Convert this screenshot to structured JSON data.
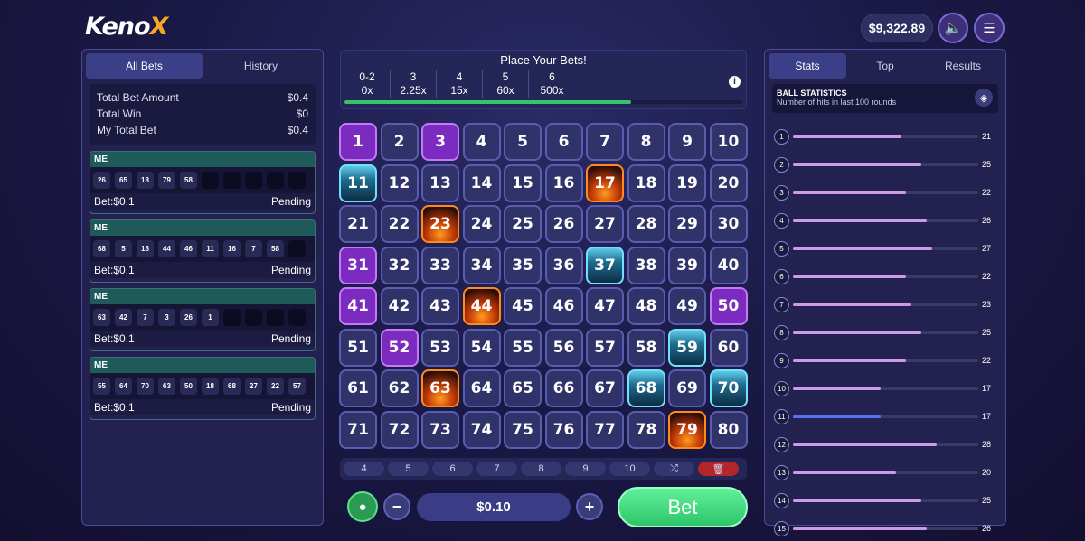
{
  "logo": {
    "main": "Keno",
    "accent": "X"
  },
  "balance": "$9,322.89",
  "left_tabs": [
    {
      "label": "All Bets"
    },
    {
      "label": "History"
    }
  ],
  "summary": [
    {
      "label": "Total Bet Amount",
      "value": "$0.4"
    },
    {
      "label": "Total Win",
      "value": "$0"
    },
    {
      "label": "My Total Bet",
      "value": "$0.4"
    }
  ],
  "bets": [
    {
      "player": "ME",
      "numbers": [
        "26",
        "65",
        "18",
        "79",
        "58",
        "",
        "",
        "",
        "",
        ""
      ],
      "bet": "Bet:$0.1",
      "status": "Pending"
    },
    {
      "player": "ME",
      "numbers": [
        "68",
        "5",
        "18",
        "44",
        "46",
        "11",
        "16",
        "7",
        "58",
        ""
      ],
      "bet": "Bet:$0.1",
      "status": "Pending"
    },
    {
      "player": "ME",
      "numbers": [
        "63",
        "42",
        "7",
        "3",
        "26",
        "1",
        "",
        "",
        "",
        ""
      ],
      "bet": "Bet:$0.1",
      "status": "Pending"
    },
    {
      "player": "ME",
      "numbers": [
        "55",
        "64",
        "70",
        "63",
        "50",
        "18",
        "68",
        "27",
        "22",
        "57"
      ],
      "bet": "Bet:$0.1",
      "status": "Pending"
    }
  ],
  "payout": {
    "title": "Place Your Bets!",
    "tiers": [
      {
        "hits": "0-2",
        "multiplier": "0x"
      },
      {
        "hits": "3",
        "multiplier": "2.25x"
      },
      {
        "hits": "4",
        "multiplier": "15x"
      },
      {
        "hits": "5",
        "multiplier": "60x"
      },
      {
        "hits": "6",
        "multiplier": "500x"
      }
    ],
    "progress": 0.72
  },
  "grid": {
    "selected": [
      1,
      3,
      31,
      41,
      50,
      52
    ],
    "hit_fire": [
      17,
      23,
      44,
      63,
      79
    ],
    "hit_ice": [
      11,
      37,
      59,
      68,
      70
    ]
  },
  "pick_options": [
    "4",
    "5",
    "6",
    "7",
    "8",
    "9",
    "10"
  ],
  "bet_amount": "$0.10",
  "bet_label": "Bet",
  "right_tabs": [
    {
      "label": "Stats"
    },
    {
      "label": "Top"
    },
    {
      "label": "Results"
    }
  ],
  "stats": {
    "title": "BALL STATISTICS",
    "subtitle": "Number of hits in last 100 rounds",
    "rows": [
      {
        "ball": "1",
        "hits": 21
      },
      {
        "ball": "2",
        "hits": 25
      },
      {
        "ball": "3",
        "hits": 22
      },
      {
        "ball": "4",
        "hits": 26
      },
      {
        "ball": "5",
        "hits": 27
      },
      {
        "ball": "6",
        "hits": 22
      },
      {
        "ball": "7",
        "hits": 23
      },
      {
        "ball": "8",
        "hits": 25
      },
      {
        "ball": "9",
        "hits": 22
      },
      {
        "ball": "10",
        "hits": 17
      },
      {
        "ball": "11",
        "hits": 17
      },
      {
        "ball": "12",
        "hits": 28
      },
      {
        "ball": "13",
        "hits": 20
      },
      {
        "ball": "14",
        "hits": 25
      },
      {
        "ball": "15",
        "hits": 26
      }
    ],
    "highlight_ball": "11"
  }
}
